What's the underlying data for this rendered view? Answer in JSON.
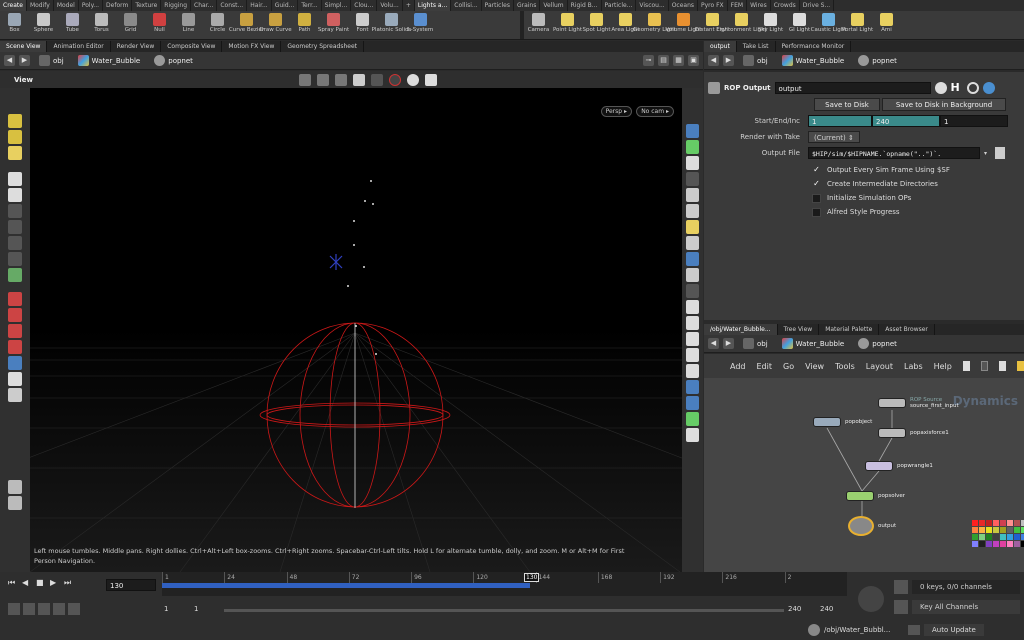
{
  "shelf_tabs": [
    "Create",
    "Modify",
    "Model",
    "Poly...",
    "Deform",
    "Texture",
    "Rigging",
    "Char...",
    "Const...",
    "Hair...",
    "Guid...",
    "Terr...",
    "Simpl...",
    "Clou...",
    "Volu...",
    "+",
    "Lights a...",
    "Collisi...",
    "Particles",
    "Grains",
    "Vellum",
    "Rigid B...",
    "Particle...",
    "Viscou...",
    "Oceans",
    "Pyro FX",
    "FEM",
    "Wires",
    "Crowds",
    "Drive S..."
  ],
  "left_tools": [
    {
      "label": "Box",
      "color": "#9aa7b5"
    },
    {
      "label": "Sphere",
      "color": "#c9c9c9"
    },
    {
      "label": "Tube",
      "color": "#aab"
    },
    {
      "label": "Torus",
      "color": "#bbb"
    },
    {
      "label": "Grid",
      "color": "#8a8a8a"
    },
    {
      "label": "Null",
      "color": "#d04040"
    },
    {
      "label": "Line",
      "color": "#999"
    },
    {
      "label": "Circle",
      "color": "#aaa"
    },
    {
      "label": "Curve Bezier",
      "color": "#c8a040"
    },
    {
      "label": "Draw Curve",
      "color": "#c8a040"
    },
    {
      "label": "Path",
      "color": "#d0b040"
    },
    {
      "label": "Spray Paint",
      "color": "#d06060"
    },
    {
      "label": "Font",
      "color": "#ccc"
    },
    {
      "label": "Platonic Solids",
      "color": "#9ab"
    },
    {
      "label": "L-System",
      "color": "#5a8fd0"
    }
  ],
  "right_tools": [
    {
      "label": "Camera",
      "color": "#bbb"
    },
    {
      "label": "Point Light",
      "color": "#e8d060"
    },
    {
      "label": "Spot Light",
      "color": "#e8d060"
    },
    {
      "label": "Area Light",
      "color": "#e8d060"
    },
    {
      "label": "Geometry Light",
      "color": "#e8c050"
    },
    {
      "label": "Volume Light",
      "color": "#e89030"
    },
    {
      "label": "Distant Light",
      "color": "#e8d060"
    },
    {
      "label": "Environment Light",
      "color": "#e8d060"
    },
    {
      "label": "Sky Light",
      "color": "#ddd"
    },
    {
      "label": "GI Light",
      "color": "#ddd"
    },
    {
      "label": "Caustic Light",
      "color": "#6ab0e0"
    },
    {
      "label": "Portal Light",
      "color": "#e8d060"
    },
    {
      "label": "Ami",
      "color": "#e8d060"
    }
  ],
  "viewer_tabs": [
    "Scene View",
    "Animation Editor",
    "Render View",
    "Composite View",
    "Motion FX View",
    "Geometry Spreadsheet"
  ],
  "path": {
    "obj": "obj",
    "object": "Water_Bubble",
    "network": "popnet"
  },
  "view_label": "View",
  "persp_label": "Persp",
  "cam_label": "No cam",
  "status_message": "Left mouse tumbles. Middle pans. Right dollies. Ctrl+Alt+Left box-zooms. Ctrl+Right zooms. Spacebar-Ctrl-Left tilts. Hold L for alternate tumble, dolly, and zoom.    M or Alt+M for First Person Navigation.",
  "param_tabs": [
    "output",
    "Take List",
    "Performance Monitor"
  ],
  "rop": {
    "type_label": "ROP Output",
    "name": "output",
    "save_disk": "Save to Disk",
    "save_bg": "Save to Disk in Background",
    "start_end_label": "Start/End/Inc",
    "start": "1",
    "end": "240",
    "inc": "1",
    "take_label": "Render with Take",
    "take_value": "(Current)",
    "file_label": "Output File",
    "file_value": "$HIP/sim/$HIPNAME.`opname(\"..\")`.",
    "checks": [
      {
        "label": "Output Every Sim Frame Using $SF",
        "checked": true
      },
      {
        "label": "Create Intermediate Directories",
        "checked": true
      },
      {
        "label": "Initialize Simulation OPs",
        "checked": false
      },
      {
        "label": "Alfred Style Progress",
        "checked": false
      }
    ]
  },
  "net_tabs": [
    "/obj/Water_Bubble...",
    "Tree View",
    "Material Palette",
    "Asset Browser"
  ],
  "net_menu": [
    "Add",
    "Edit",
    "Go",
    "View",
    "Tools",
    "Layout",
    "Labs",
    "Help"
  ],
  "net_context": "Dynamics",
  "nodes": {
    "source_tag": "ROP Source",
    "source": "source_first_input",
    "popobject": "popobject",
    "popaxisforce": "popaxisforce1",
    "poprangle": "popwrangle1",
    "popsolver": "popsolver",
    "output": "output"
  },
  "timeline": {
    "frame": "130",
    "ticks": [
      "1",
      "24",
      "48",
      "72",
      "96",
      "120",
      "144",
      "168",
      "192",
      "216",
      "2"
    ],
    "marker": "130",
    "range_start": "1",
    "range_start2": "1",
    "range_end": "240",
    "range_end2": "240",
    "keys": "0 keys, 0/0 channels",
    "key_all": "Key All Channels"
  },
  "footer": {
    "path": "/obj/Water_Bubbl...",
    "update": "Auto Update"
  },
  "swatches": [
    "#ff2020",
    "#e82828",
    "#c02020",
    "#ff6060",
    "#d04050",
    "#ff9090",
    "#b05050",
    "#c0c0c0",
    "#ff8040",
    "#ffb040",
    "#e8e020",
    "#c8c840",
    "#a0a020",
    "#606060",
    "#40c040",
    "#60e060",
    "#30a030",
    "#80d080",
    "#208020",
    "#404040",
    "#40c0c0",
    "#30a0e0",
    "#2060d0",
    "#4080e0",
    "#8080ff",
    "#202020",
    "#8040c0",
    "#c040c0",
    "#e040a0",
    "#ff80c0",
    "#a060a0",
    "#000000"
  ]
}
